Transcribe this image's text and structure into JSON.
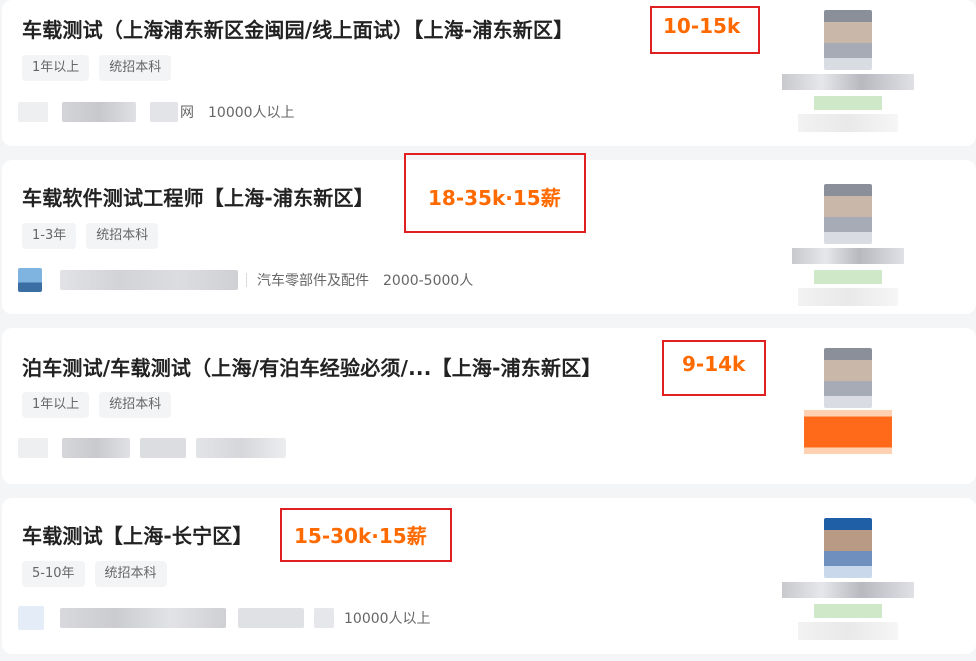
{
  "jobs": [
    {
      "title": "车载测试（上海浦东新区金闽园/线上面试）【上海-浦东新区】",
      "salary": "10-15k",
      "tags": [
        "1年以上",
        "统招本科"
      ],
      "company_meta": [
        "网",
        "10000人以上"
      ]
    },
    {
      "title": "车载软件测试工程师【上海-浦东新区】",
      "salary": "18-35k·15薪",
      "tags": [
        "1-3年",
        "统招本科"
      ],
      "company_meta": [
        "汽车零部件及配件",
        "2000-5000人"
      ]
    },
    {
      "title": "泊车测试/车载测试（上海/有泊车经验必须/...【上海-浦东新区】",
      "salary": "9-14k",
      "tags": [
        "1年以上",
        "统招本科"
      ],
      "company_meta": []
    },
    {
      "title": "车载测试【上海-长宁区】",
      "salary": "15-30k·15薪",
      "tags": [
        "5-10年",
        "统招本科"
      ],
      "company_meta": [
        "10000人以上"
      ]
    }
  ]
}
